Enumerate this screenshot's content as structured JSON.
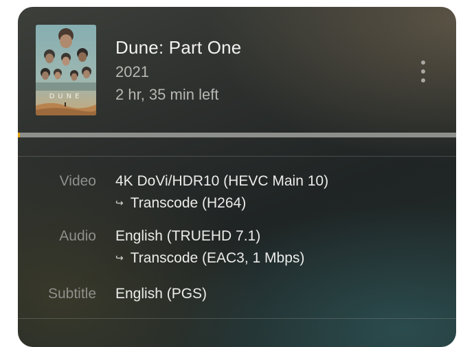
{
  "media": {
    "title": "Dune: Part One",
    "year": "2021",
    "time_left": "2 hr, 35 min left",
    "poster_text": "DUNE",
    "progress_fraction": 0.0
  },
  "menu": {
    "icon": "more-vertical-icon"
  },
  "details": {
    "video": {
      "label": "Video",
      "line1": "4K DoVi/HDR10 (HEVC Main 10)",
      "line2": "Transcode (H264)"
    },
    "audio": {
      "label": "Audio",
      "line1": "English (TRUEHD 7.1)",
      "line2": "Transcode (EAC3, 1 Mbps)"
    },
    "subtitle": {
      "label": "Subtitle",
      "line1": "English (PGS)"
    }
  },
  "colors": {
    "accent": "#e5a00d",
    "text_primary": "#f2f2f0",
    "text_secondary": "#b9b8b2",
    "label": "#8f908b"
  }
}
